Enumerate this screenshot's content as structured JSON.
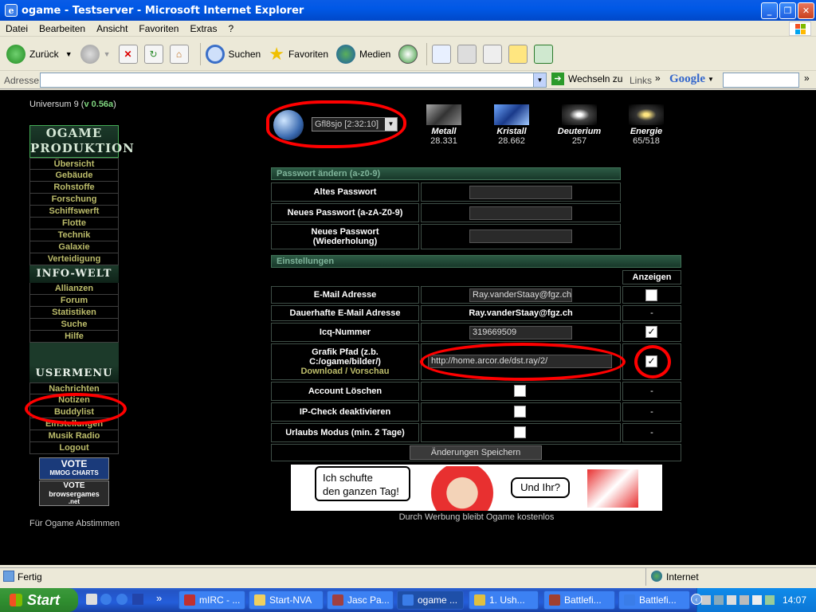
{
  "window": {
    "title": "ogame - Testserver - Microsoft Internet Explorer",
    "min": "_",
    "max": "❐",
    "close": "✕"
  },
  "menu": [
    "Datei",
    "Bearbeiten",
    "Ansicht",
    "Favoriten",
    "Extras",
    "?"
  ],
  "toolbar": {
    "back": "Zurück",
    "search": "Suchen",
    "favorites": "Favoriten",
    "media": "Medien"
  },
  "address": {
    "label": "Adresse",
    "value": "",
    "go": "Wechseln zu",
    "links": "Links",
    "google": "Google"
  },
  "page": {
    "universe": "Universum 9 (",
    "version": "v 0.56a",
    "universe_close": ")",
    "banner_top": "OGAME\nPRODUKTION",
    "banner_info": "INFO-WELT",
    "banner_user": "USERMENU",
    "nav1": [
      "Übersicht",
      "Gebäude",
      "Rohstoffe",
      "Forschung",
      "Schiffswerft",
      "Flotte",
      "Technik",
      "Galaxie",
      "Verteidigung"
    ],
    "nav2": [
      "Allianzen",
      "Forum",
      "Statistiken",
      "Suche",
      "Hilfe"
    ],
    "nav3": [
      "Nachrichten",
      "Notizen",
      "Buddylist",
      "Einstellungen",
      "Musik Radio",
      "Logout"
    ],
    "vote1_a": "VOTE",
    "vote1_b": "MMOG CHARTS",
    "vote2_a": "VOTE",
    "vote2_b": "browsergames",
    "vote2_c": ".net",
    "vote_text": "Für Ogame Abstimmen",
    "planet_select": "Gfl8sjo [2:32:10]",
    "resources": [
      {
        "name": "Metall",
        "value": "28.331"
      },
      {
        "name": "Kristall",
        "value": "28.662"
      },
      {
        "name": "Deuterium",
        "value": "257"
      },
      {
        "name": "Energie",
        "value": "65/518"
      }
    ],
    "pw_header": "Passwort ändern (a-z0-9)",
    "pw_old": "Altes Passwort",
    "pw_new": "Neues Passwort (a-zA-Z0-9)",
    "pw_repeat": "Neues Passwort (Wiederholung)",
    "settings_header": "Einstellungen",
    "show_label": "Anzeigen",
    "email_label": "E-Mail Adresse",
    "email_value": "Ray.vanderStaay@fgz.ch",
    "perm_email_label": "Dauerhafte E-Mail Adresse",
    "perm_email_value": "Ray.vanderStaay@fgz.ch",
    "perm_email_show": "-",
    "icq_label": "Icq-Nummer",
    "icq_value": "319669509",
    "gfx_label": "Grafik Pfad (z.b. C:/ogame/bilder/)",
    "gfx_link": "Download / Vorschau",
    "gfx_value": "http://home.arcor.de/dst.ray/2/",
    "acct_del": "Account Löschen",
    "ipcheck": "IP-Check deaktivieren",
    "vacation": "Urlaubs Modus (min. 2 Tage)",
    "dash": "-",
    "save": "Änderungen Speichern",
    "ad_bubble1": "Ich schufte\nden ganzen Tag!",
    "ad_bubble2": "Und Ihr?",
    "ad_caption": "Durch Werbung bleibt Ogame kostenlos"
  },
  "status": {
    "text": "Fertig",
    "zone": "Internet"
  },
  "taskbar": {
    "start": "Start",
    "tasks": [
      "mIRC - ...",
      "Start-NVA",
      "Jasc Pa...",
      "ogame ...",
      "1. Ush...",
      "Battlefi...",
      "Battlefi..."
    ],
    "clock": "14:07"
  },
  "colors": {
    "accent_red": "#ff0000",
    "nav_text": "#bdbd6b",
    "header_green": "#2c5a44"
  }
}
